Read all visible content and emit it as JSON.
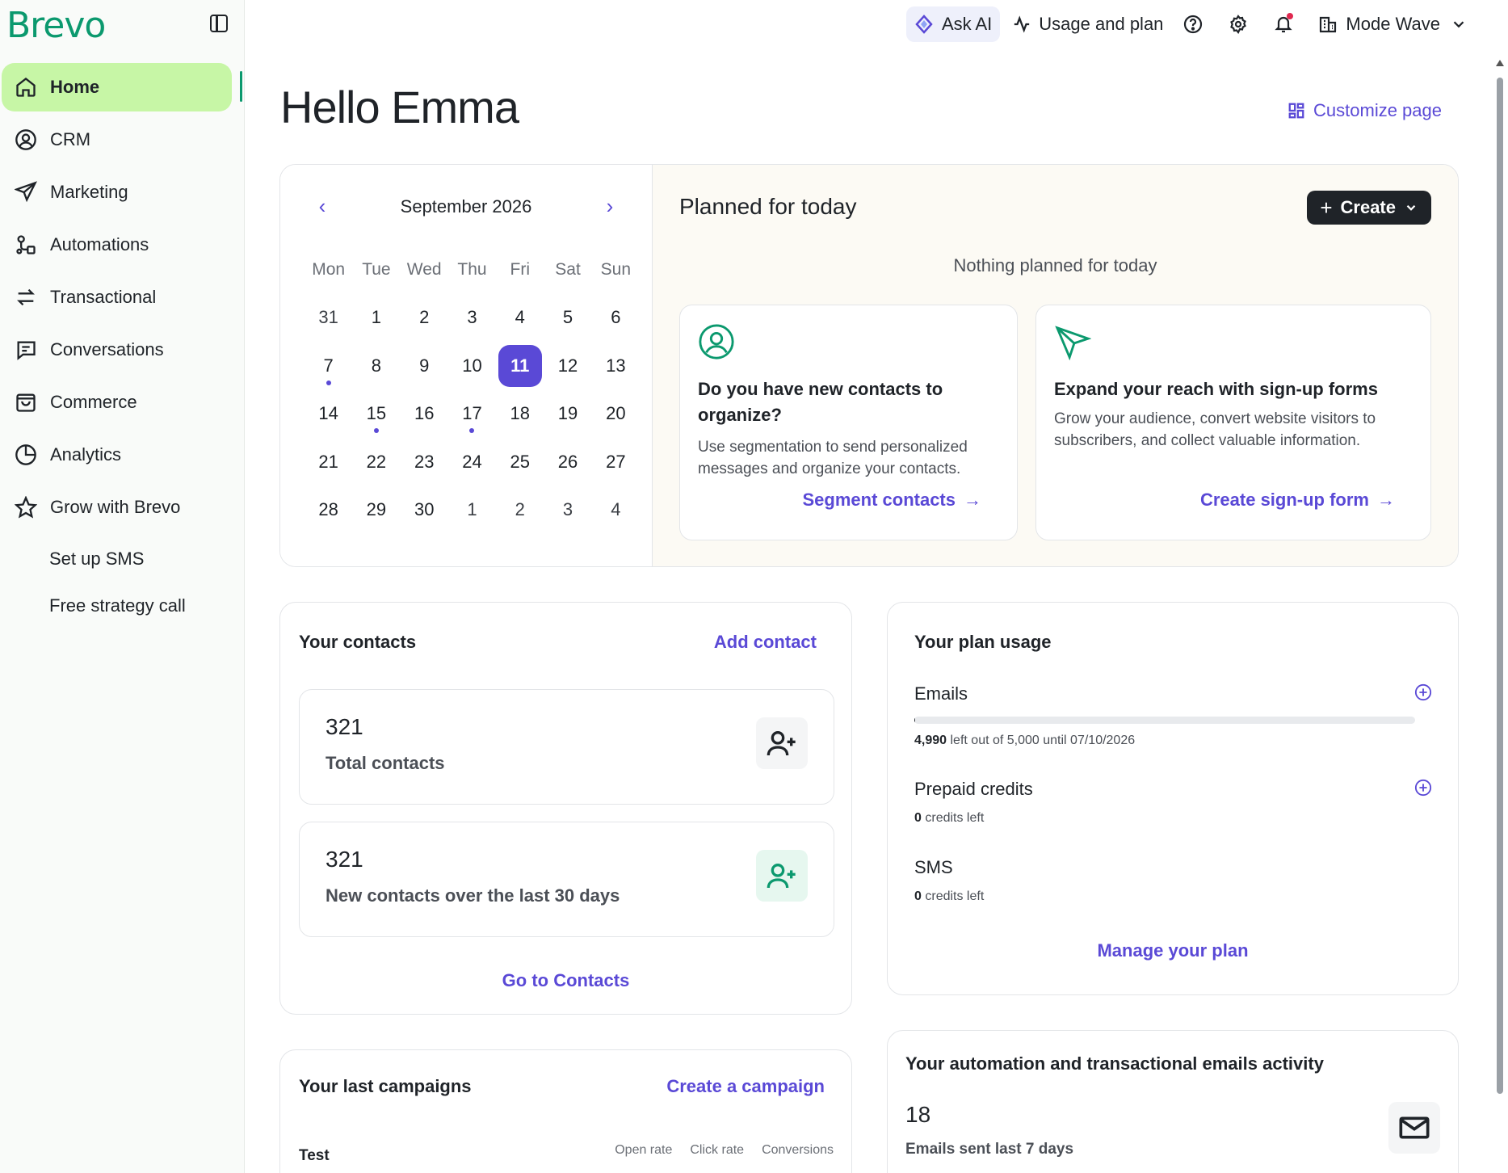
{
  "brand": {
    "logo": "Brevo",
    "accent": "#0b996e",
    "primary": "#5a49d6"
  },
  "sidebar": {
    "items": [
      {
        "label": "Home",
        "icon": "home-icon",
        "active": true
      },
      {
        "label": "CRM",
        "icon": "user-circle-icon"
      },
      {
        "label": "Marketing",
        "icon": "send-icon"
      },
      {
        "label": "Automations",
        "icon": "automation-icon"
      },
      {
        "label": "Transactional",
        "icon": "arrows-exchange-icon"
      },
      {
        "label": "Conversations",
        "icon": "chat-icon"
      },
      {
        "label": "Commerce",
        "icon": "shopping-bag-icon"
      },
      {
        "label": "Analytics",
        "icon": "pie-chart-icon"
      },
      {
        "label": "Grow with Brevo",
        "icon": "star-icon"
      }
    ],
    "sub_items": [
      {
        "label": "Set up SMS"
      },
      {
        "label": "Free strategy call"
      }
    ]
  },
  "topbar": {
    "ask_ai": "Ask AI",
    "usage": "Usage and plan",
    "org": "Mode Wave"
  },
  "page": {
    "greeting": "Hello Emma",
    "customize": "Customize page"
  },
  "calendar": {
    "month": "September 2026",
    "weekdays": [
      "Mon",
      "Tue",
      "Wed",
      "Thu",
      "Fri",
      "Sat",
      "Sun"
    ],
    "weeks": [
      [
        "31",
        "1",
        "2",
        "3",
        "4",
        "5",
        "6"
      ],
      [
        "7",
        "8",
        "9",
        "10",
        "11",
        "12",
        "13"
      ],
      [
        "14",
        "15",
        "16",
        "17",
        "18",
        "19",
        "20"
      ],
      [
        "21",
        "22",
        "23",
        "24",
        "25",
        "26",
        "27"
      ],
      [
        "28",
        "29",
        "30",
        "1",
        "2",
        "3",
        "4"
      ]
    ],
    "today": "11",
    "event_days": [
      "7",
      "15",
      "17"
    ]
  },
  "planned": {
    "title": "Planned for today",
    "create": "Create",
    "empty": "Nothing planned for today",
    "tips": [
      {
        "title": "Do you have new contacts to organize?",
        "body": "Use segmentation to send personalized messages and organize your contacts.",
        "link": "Segment contacts"
      },
      {
        "title": "Expand your reach with sign-up forms",
        "body": "Grow your audience, convert website visitors to subscribers, and collect valuable information.",
        "link": "Create sign-up form"
      }
    ]
  },
  "contacts": {
    "title": "Your contacts",
    "add": "Add contact",
    "stats": [
      {
        "value": "321",
        "label": "Total contacts"
      },
      {
        "value": "321",
        "label": "New contacts over the last 30 days"
      }
    ],
    "go": "Go to Contacts"
  },
  "plan": {
    "title": "Your plan usage",
    "emails": {
      "label": "Emails",
      "left": "4,990",
      "suffix": "left out of 5,000 until 07/10/2026",
      "used_fraction": 0.002
    },
    "prepaid": {
      "label": "Prepaid credits",
      "left": "0",
      "suffix": "credits left"
    },
    "sms": {
      "label": "SMS",
      "left": "0",
      "suffix": "credits left"
    },
    "manage": "Manage your plan"
  },
  "campaigns": {
    "title": "Your last campaigns",
    "create": "Create a campaign",
    "row_name": "Test",
    "columns": [
      "Open rate",
      "Click rate",
      "Conversions"
    ]
  },
  "activity": {
    "title": "Your automation and transactional emails activity",
    "value": "18",
    "label": "Emails sent last 7 days"
  }
}
